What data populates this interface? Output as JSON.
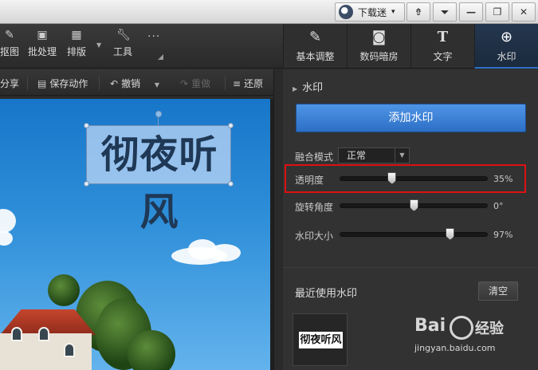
{
  "titlebar": {
    "brand_label": "下载迷",
    "buttons": [
      "⇮",
      "⏷",
      "—",
      "❐",
      "✕"
    ]
  },
  "toolbar": {
    "tools": [
      {
        "label": "抠图",
        "icon": "pin-icon"
      },
      {
        "label": "批处理",
        "icon": "batch-icon"
      },
      {
        "label": "排版",
        "icon": "layout-icon"
      },
      {
        "label": "工具",
        "icon": "wrench-icon"
      }
    ],
    "more": "···"
  },
  "tabs": [
    {
      "label": "基本调整",
      "icon": "edit-icon",
      "active": false
    },
    {
      "label": "数码暗房",
      "icon": "camera-icon",
      "active": false
    },
    {
      "label": "文字",
      "icon": "text-icon",
      "active": false
    },
    {
      "label": "水印",
      "icon": "watermark-icon",
      "active": true
    }
  ],
  "actions": {
    "share": "分享",
    "save_action": "保存动作",
    "undo": "撤销",
    "redo": "重做",
    "restore": "还原"
  },
  "canvas": {
    "watermark_text": "彻夜听风"
  },
  "panel": {
    "section_title": "水印",
    "add_button": "添加水印",
    "blend_label": "融合模式",
    "blend_value": "正常",
    "sliders": [
      {
        "label": "透明度",
        "value": 35,
        "display": "35%"
      },
      {
        "label": "旋转角度",
        "value": 0,
        "display": "0°"
      },
      {
        "label": "水印大小",
        "value": 97,
        "display": "97%"
      }
    ],
    "recent_title": "最近使用水印",
    "clear_button": "清空",
    "recent_items": [
      "彻夜听风"
    ]
  },
  "watermark_logo": {
    "brand": "Bai",
    "brand_cn": "经验",
    "url": "jingyan.baidu.com"
  }
}
